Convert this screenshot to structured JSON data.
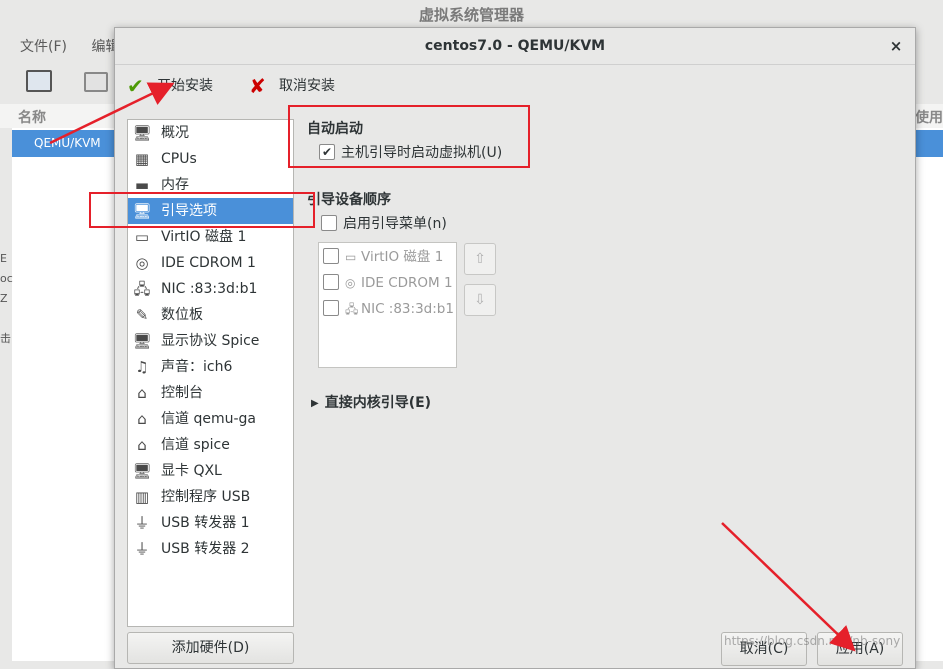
{
  "background_window": {
    "title": "虚拟系统管理器",
    "menu": [
      "文件(F)",
      "编辑"
    ],
    "column_name": "名称",
    "column_usage": "使用",
    "selected_row": "QEMU/KVM",
    "left_fragments": [
      "E",
      "oc",
      "Z",
      "击"
    ]
  },
  "dialog": {
    "title": "centos7.0 - QEMU/KVM",
    "close_glyph": "×",
    "toolbar": {
      "begin_install": "开始安装",
      "cancel_install": "取消安装"
    },
    "sidebar": [
      {
        "label": "概况",
        "icon": "monitor-icon",
        "glyph": "🖥"
      },
      {
        "label": "CPUs",
        "icon": "cpu-icon",
        "glyph": "▦"
      },
      {
        "label": "内存",
        "icon": "memory-icon",
        "glyph": "▬"
      },
      {
        "label": "引导选项",
        "icon": "boot-options-icon",
        "glyph": "🖥"
      },
      {
        "label": "VirtIO 磁盘 1",
        "icon": "disk-icon",
        "glyph": "▭"
      },
      {
        "label": "IDE CDROM 1",
        "icon": "cdrom-icon",
        "glyph": "◎"
      },
      {
        "label": "NIC :83:3d:b1",
        "icon": "network-icon",
        "glyph": "🖧"
      },
      {
        "label": "数位板",
        "icon": "tablet-icon",
        "glyph": "✎"
      },
      {
        "label": "显示协议  Spice",
        "icon": "display-icon",
        "glyph": "🖥"
      },
      {
        "label": "声音：ich6",
        "icon": "sound-icon",
        "glyph": "♫"
      },
      {
        "label": "控制台",
        "icon": "console-icon",
        "glyph": "⌂"
      },
      {
        "label": "信道  qemu-ga",
        "icon": "channel-icon",
        "glyph": "⌂"
      },
      {
        "label": "信道  spice",
        "icon": "channel-icon",
        "glyph": "⌂"
      },
      {
        "label": "显卡  QXL",
        "icon": "video-card-icon",
        "glyph": "🖥"
      },
      {
        "label": "控制程序  USB",
        "icon": "controller-icon",
        "glyph": "▥"
      },
      {
        "label": "USB 转发器 1",
        "icon": "usb-icon",
        "glyph": "⏚"
      },
      {
        "label": "USB 转发器 2",
        "icon": "usb-icon",
        "glyph": "⏚"
      }
    ],
    "add_hardware": "添加硬件(D)",
    "autostart": {
      "title": "自动启动",
      "checkbox_label": "主机引导时启动虚拟机(U)",
      "checked": true
    },
    "boot_order": {
      "title": "引导设备顺序",
      "enable_menu_label": "启用引导菜单(n)",
      "devices": [
        {
          "label": "VirtIO 磁盘 1",
          "glyph": "▭"
        },
        {
          "label": "IDE CDROM 1",
          "glyph": "◎"
        },
        {
          "label": "NIC :83:3d:b1",
          "glyph": "🖧"
        }
      ],
      "up_glyph": "⇧",
      "down_glyph": "⇩"
    },
    "direct_kernel": {
      "label": "直接内核引导(E)",
      "glyph": "▶"
    },
    "buttons": {
      "cancel": "取消(C)",
      "apply": "应用(A)"
    },
    "watermark": "https://blog.csdn.net/nb-sony"
  },
  "colors": {
    "selection_blue": "#4a90d9",
    "annotation_red": "#e5202a"
  }
}
